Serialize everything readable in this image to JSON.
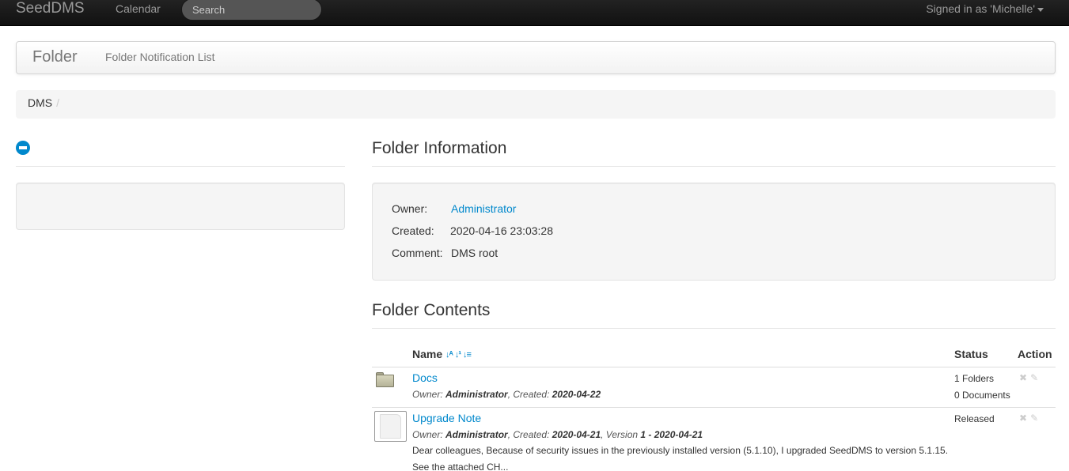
{
  "navbar": {
    "brand": "SeedDMS",
    "calendar": "Calendar",
    "search_placeholder": "Search",
    "user_menu": "Signed in as 'Michelle'"
  },
  "subnav": {
    "title": "Folder",
    "link": "Folder Notification List"
  },
  "breadcrumb": {
    "items": [
      "DMS"
    ],
    "divider": "/"
  },
  "folder_info": {
    "title": "Folder Information",
    "owner_label": "Owner:",
    "owner_value": "Administrator",
    "created_label": "Created:",
    "created_value": "2020-04-16 23:03:28",
    "comment_label": "Comment:",
    "comment_value": "DMS root"
  },
  "folder_contents": {
    "title": "Folder Contents",
    "headers": {
      "name": "Name",
      "status": "Status",
      "action": "Action"
    },
    "sort_icons": [
      "sort-alpha-icon",
      "sort-numeric-icon",
      "sort-list-icon"
    ],
    "rows": [
      {
        "type": "folder",
        "name": "Docs",
        "meta_owner_label": "Owner: ",
        "meta_owner": "Administrator",
        "meta_created_label": ", Created: ",
        "meta_created": "2020-04-22",
        "status_line1": "1 Folders",
        "status_line2": "0 Documents"
      },
      {
        "type": "document",
        "name": "Upgrade Note",
        "meta_owner_label": "Owner: ",
        "meta_owner": "Administrator",
        "meta_created_label": ", Created: ",
        "meta_created": "2020-04-21",
        "meta_version_label": ", Version ",
        "meta_version": "1 - 2020-04-21",
        "comment_line1": "Dear colleagues, Because of security issues in the previously installed version (5.1.10), I upgraded SeedDMS to version 5.1.15.",
        "comment_line2": "See the attached CH...",
        "status_line1": "Released"
      }
    ]
  },
  "icons": {
    "delete": "✖",
    "edit": "✎"
  }
}
